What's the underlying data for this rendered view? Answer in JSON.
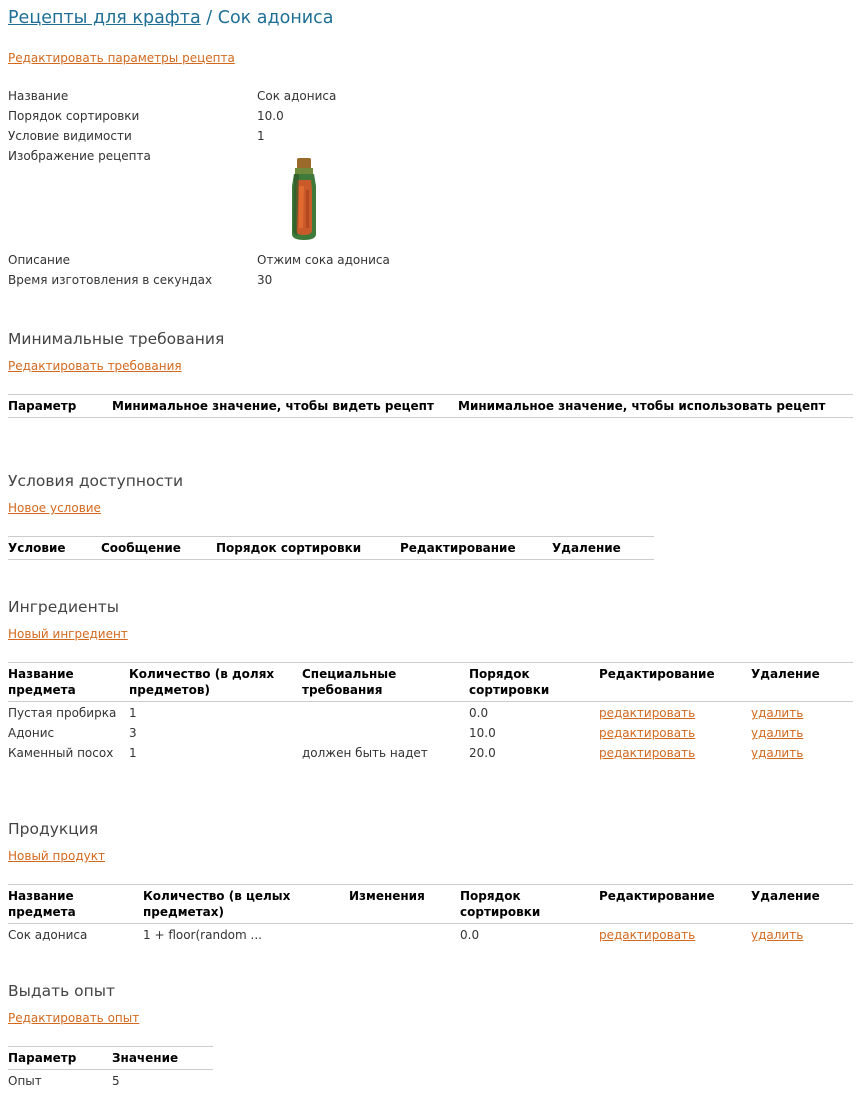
{
  "breadcrumb": {
    "parent": "Рецепты для крафта",
    "separator": "/",
    "current": "Сок адониса"
  },
  "recipe": {
    "edit_link": "Редактировать параметры рецепта",
    "fields": {
      "name": {
        "label": "Название",
        "value": "Сок адониса"
      },
      "sort_order": {
        "label": "Порядок сортировки",
        "value": "10.0"
      },
      "visibility": {
        "label": "Условие видимости",
        "value": "1"
      },
      "image": {
        "label": "Изображение рецепта",
        "icon": "juice-bottle-icon"
      },
      "description": {
        "label": "Описание",
        "value": "Отжим сока адониса"
      },
      "craft_time": {
        "label": "Время изготовления в секундах",
        "value": "30"
      }
    }
  },
  "min_requirements": {
    "title": "Минимальные требования",
    "edit_link": "Редактировать требования",
    "columns": [
      "Параметр",
      "Минимальное значение, чтобы видеть рецепт",
      "Минимальное значение, чтобы использовать рецепт"
    ]
  },
  "availability": {
    "title": "Условия доступности",
    "new_link": "Новое условие",
    "columns": [
      "Условие",
      "Сообщение",
      "Порядок сортировки",
      "Редактирование",
      "Удаление"
    ]
  },
  "ingredients": {
    "title": "Ингредиенты",
    "new_link": "Новый ингредиент",
    "columns": [
      "Название предмета",
      "Количество (в долях предметов)",
      "Специальные требования",
      "Порядок сортировки",
      "Редактирование",
      "Удаление"
    ],
    "rows": [
      {
        "name": "Пустая пробирка",
        "qty": "1",
        "special": "",
        "sort": "0.0",
        "edit": "редактировать",
        "delete": "удалить"
      },
      {
        "name": "Адонис",
        "qty": "3",
        "special": "",
        "sort": "10.0",
        "edit": "редактировать",
        "delete": "удалить"
      },
      {
        "name": "Каменный посох",
        "qty": "1",
        "special": "должен быть надет",
        "sort": "20.0",
        "edit": "редактировать",
        "delete": "удалить"
      }
    ]
  },
  "products": {
    "title": "Продукция",
    "new_link": "Новый продукт",
    "columns": [
      "Название предмета",
      "Количество (в целых предметах)",
      "Изменения",
      "Порядок сортировки",
      "Редактирование",
      "Удаление"
    ],
    "rows": [
      {
        "name": "Сок адониса",
        "qty": "1 + floor(random ...",
        "changes": "",
        "sort": "0.0",
        "edit": "редактировать",
        "delete": "удалить"
      }
    ]
  },
  "experience": {
    "title": "Выдать опыт",
    "edit_link": "Редактировать опыт",
    "columns": [
      "Параметр",
      "Значение"
    ],
    "rows": [
      {
        "param": "Опыт",
        "value": "5"
      }
    ]
  }
}
